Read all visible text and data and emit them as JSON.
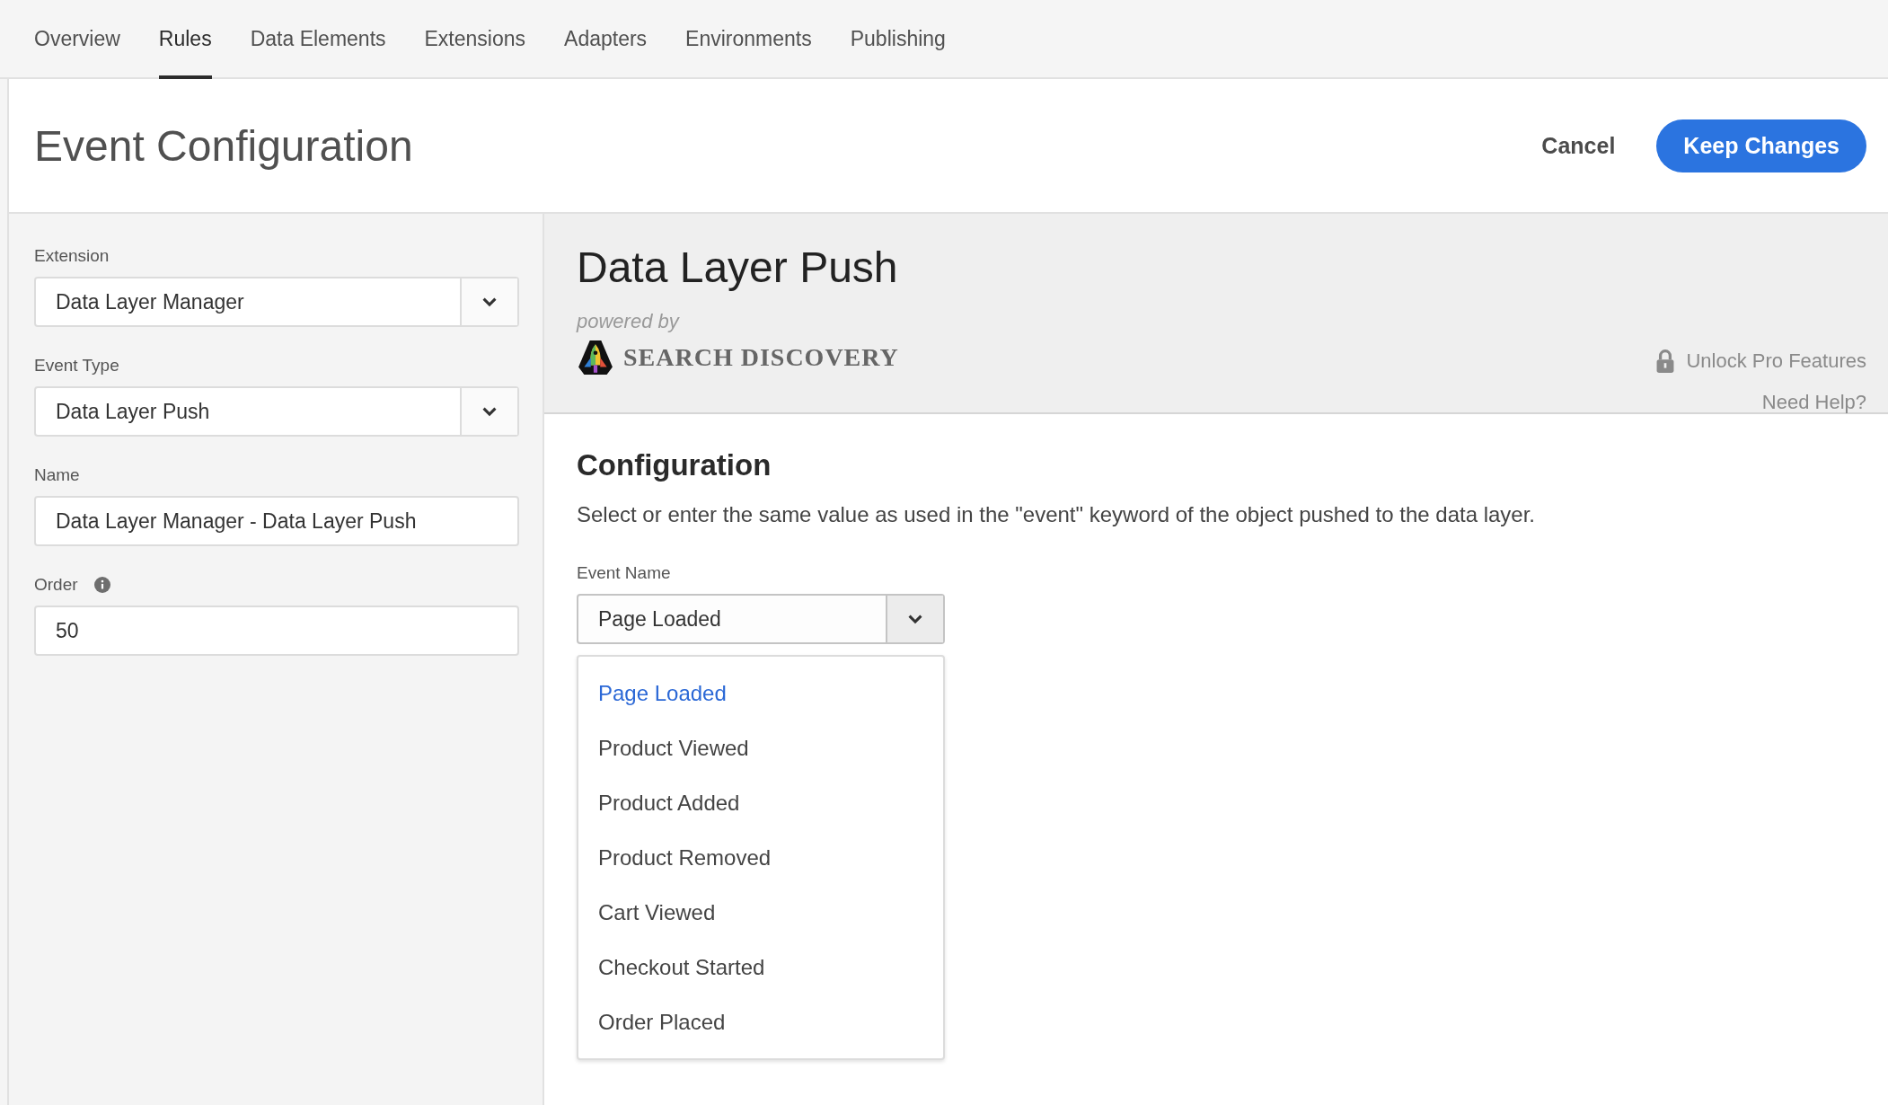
{
  "tabs": [
    {
      "label": "Overview",
      "selected": false
    },
    {
      "label": "Rules",
      "selected": true
    },
    {
      "label": "Data Elements",
      "selected": false
    },
    {
      "label": "Extensions",
      "selected": false
    },
    {
      "label": "Adapters",
      "selected": false
    },
    {
      "label": "Environments",
      "selected": false
    },
    {
      "label": "Publishing",
      "selected": false
    }
  ],
  "header": {
    "title": "Event Configuration",
    "cancel": "Cancel",
    "confirm": "Keep Changes"
  },
  "form": [
    {
      "label": "Extension",
      "value": "Data Layer Manager",
      "kind": "select",
      "info": false
    },
    {
      "label": "Event Type",
      "value": "Data Layer Push",
      "kind": "select",
      "info": false
    },
    {
      "label": "Name",
      "value": "Data Layer Manager - Data Layer Push",
      "kind": "text",
      "info": false
    },
    {
      "label": "Order",
      "value": "50",
      "kind": "text",
      "info": true
    }
  ],
  "extension": {
    "title": "Data Layer Push",
    "powered_by": "powered by",
    "brand": "SEARCH DISCOVERY",
    "unlock": "Unlock Pro Features",
    "help": "Need Help?"
  },
  "configuration": {
    "heading": "Configuration",
    "description": "Select or enter the same value as used in the \"event\" keyword of the object pushed to the data layer.",
    "event_name": {
      "label": "Event Name",
      "value": "Page Loaded",
      "expanded": true,
      "options": [
        {
          "label": "Page Loaded",
          "selected": true
        },
        {
          "label": "Product Viewed",
          "selected": false
        },
        {
          "label": "Product Added",
          "selected": false
        },
        {
          "label": "Product Removed",
          "selected": false
        },
        {
          "label": "Cart Viewed",
          "selected": false
        },
        {
          "label": "Checkout Started",
          "selected": false
        },
        {
          "label": "Order Placed",
          "selected": false
        }
      ]
    }
  }
}
